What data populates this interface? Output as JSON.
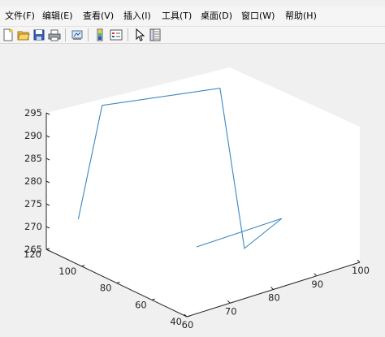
{
  "menu": {
    "items": [
      "文件(F)",
      "编辑(E)",
      "查看(V)",
      "插入(I)",
      "工具(T)",
      "桌面(D)",
      "窗口(W)",
      "帮助(H)"
    ]
  },
  "toolbar": {
    "icons": [
      "new-figure-icon",
      "open-file-icon",
      "save-icon",
      "print-icon",
      "link-plot-icon",
      "insert-colorbar-icon",
      "insert-legend-icon",
      "edit-plot-arrow-icon",
      "property-inspector-icon"
    ]
  },
  "colors": {
    "line": "#3b87c0",
    "axes_face": "#ffffff",
    "figure_bg": "#f0f0f0"
  },
  "chart_data": {
    "type": "line",
    "projection": "3d",
    "xlim": [
      60,
      100
    ],
    "ylim": [
      40,
      120
    ],
    "zlim": [
      265,
      295
    ],
    "x_ticks": [
      "60",
      "70",
      "80",
      "90",
      "100"
    ],
    "y_ticks": [
      "40",
      "60",
      "80",
      "100",
      "120"
    ],
    "z_ticks": [
      "265",
      "270",
      "275",
      "280",
      "285",
      "290",
      "295"
    ],
    "grid": false,
    "series": [
      {
        "x": [
          60.0,
          66.0,
          85.1,
          74.7,
          83.6,
          64.5
        ],
        "y": [
          101.8,
          103.0,
          82.9,
          43.4,
          44.0,
          45.5
        ],
        "z": [
          275.0,
          298.0,
          299.8,
          275.0,
          278.8,
          278.0
        ]
      }
    ]
  }
}
